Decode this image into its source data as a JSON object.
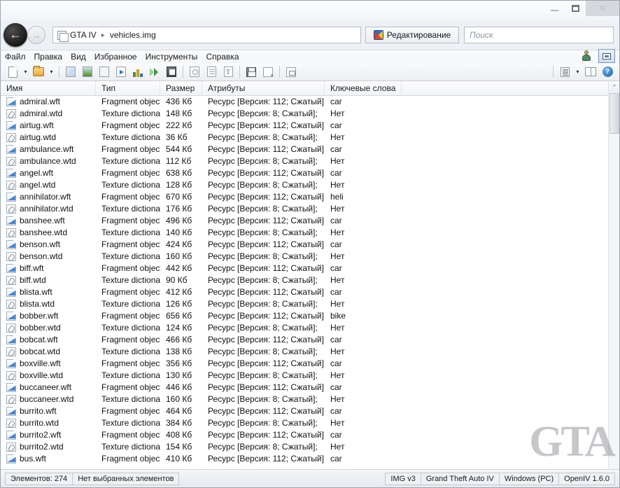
{
  "window": {
    "minimize_label": "–",
    "maximize_label": "□",
    "close_label": "✕"
  },
  "address": {
    "back_label": "←",
    "forward_label": "→",
    "crumb_root": "GTA IV",
    "crumb_sep": "▸",
    "crumb_current": "vehicles.img",
    "edit_button": "Редактирование",
    "search_placeholder": "Поиск"
  },
  "menu": {
    "items": [
      {
        "label": "Файл"
      },
      {
        "label": "Правка"
      },
      {
        "label": "Вид"
      },
      {
        "label": "Избранное"
      },
      {
        "label": "Инструменты"
      },
      {
        "label": "Справка"
      }
    ]
  },
  "toolbar": {
    "help_glyph": "?",
    "caret": "▾"
  },
  "columns": [
    {
      "key": "name",
      "label": "Имя"
    },
    {
      "key": "type",
      "label": "Тип"
    },
    {
      "key": "size",
      "label": "Размер"
    },
    {
      "key": "attr",
      "label": "Атрибуты"
    },
    {
      "key": "kw",
      "label": "Ключевые слова"
    }
  ],
  "rows": [
    {
      "icon": "wft",
      "name": "admiral.wft",
      "type": "Fragment object",
      "size": "436 Кб",
      "attr": "Ресурс [Версия: 112; Сжатый];",
      "kw": "car"
    },
    {
      "icon": "wtd",
      "name": "admiral.wtd",
      "type": "Texture dictionary",
      "size": "148 Кб",
      "attr": "Ресурс [Версия: 8; Сжатый];",
      "kw": "Нет"
    },
    {
      "icon": "wft",
      "name": "airtug.wft",
      "type": "Fragment object",
      "size": "222 Кб",
      "attr": "Ресурс [Версия: 112; Сжатый];",
      "kw": "car"
    },
    {
      "icon": "wtd",
      "name": "airtug.wtd",
      "type": "Texture dictionary",
      "size": "36 Кб",
      "attr": "Ресурс [Версия: 8; Сжатый];",
      "kw": "Нет"
    },
    {
      "icon": "wft",
      "name": "ambulance.wft",
      "type": "Fragment object",
      "size": "544 Кб",
      "attr": "Ресурс [Версия: 112; Сжатый];",
      "kw": "car"
    },
    {
      "icon": "wtd",
      "name": "ambulance.wtd",
      "type": "Texture dictionary",
      "size": "112 Кб",
      "attr": "Ресурс [Версия: 8; Сжатый];",
      "kw": "Нет"
    },
    {
      "icon": "wft",
      "name": "angel.wft",
      "type": "Fragment object",
      "size": "638 Кб",
      "attr": "Ресурс [Версия: 112; Сжатый];",
      "kw": "car"
    },
    {
      "icon": "wtd",
      "name": "angel.wtd",
      "type": "Texture dictionary",
      "size": "128 Кб",
      "attr": "Ресурс [Версия: 8; Сжатый];",
      "kw": "Нет"
    },
    {
      "icon": "wft",
      "name": "annihilator.wft",
      "type": "Fragment object",
      "size": "670 Кб",
      "attr": "Ресурс [Версия: 112; Сжатый];",
      "kw": "heli"
    },
    {
      "icon": "wtd",
      "name": "annihilator.wtd",
      "type": "Texture dictionary",
      "size": "176 Кб",
      "attr": "Ресурс [Версия: 8; Сжатый];",
      "kw": "Нет"
    },
    {
      "icon": "wft",
      "name": "banshee.wft",
      "type": "Fragment object",
      "size": "496 Кб",
      "attr": "Ресурс [Версия: 112; Сжатый];",
      "kw": "car"
    },
    {
      "icon": "wtd",
      "name": "banshee.wtd",
      "type": "Texture dictionary",
      "size": "140 Кб",
      "attr": "Ресурс [Версия: 8; Сжатый];",
      "kw": "Нет"
    },
    {
      "icon": "wft",
      "name": "benson.wft",
      "type": "Fragment object",
      "size": "424 Кб",
      "attr": "Ресурс [Версия: 112; Сжатый];",
      "kw": "car"
    },
    {
      "icon": "wtd",
      "name": "benson.wtd",
      "type": "Texture dictionary",
      "size": "160 Кб",
      "attr": "Ресурс [Версия: 8; Сжатый];",
      "kw": "Нет"
    },
    {
      "icon": "wft",
      "name": "biff.wft",
      "type": "Fragment object",
      "size": "442 Кб",
      "attr": "Ресурс [Версия: 112; Сжатый];",
      "kw": "car"
    },
    {
      "icon": "wtd",
      "name": "biff.wtd",
      "type": "Texture dictionary",
      "size": "90 Кб",
      "attr": "Ресурс [Версия: 8; Сжатый];",
      "kw": "Нет"
    },
    {
      "icon": "wft",
      "name": "blista.wft",
      "type": "Fragment object",
      "size": "412 Кб",
      "attr": "Ресурс [Версия: 112; Сжатый];",
      "kw": "car"
    },
    {
      "icon": "wtd",
      "name": "blista.wtd",
      "type": "Texture dictionary",
      "size": "126 Кб",
      "attr": "Ресурс [Версия: 8; Сжатый];",
      "kw": "Нет"
    },
    {
      "icon": "wft",
      "name": "bobber.wft",
      "type": "Fragment object",
      "size": "656 Кб",
      "attr": "Ресурс [Версия: 112; Сжатый];",
      "kw": "bike"
    },
    {
      "icon": "wtd",
      "name": "bobber.wtd",
      "type": "Texture dictionary",
      "size": "124 Кб",
      "attr": "Ресурс [Версия: 8; Сжатый];",
      "kw": "Нет"
    },
    {
      "icon": "wft",
      "name": "bobcat.wft",
      "type": "Fragment object",
      "size": "466 Кб",
      "attr": "Ресурс [Версия: 112; Сжатый];",
      "kw": "car"
    },
    {
      "icon": "wtd",
      "name": "bobcat.wtd",
      "type": "Texture dictionary",
      "size": "138 Кб",
      "attr": "Ресурс [Версия: 8; Сжатый];",
      "kw": "Нет"
    },
    {
      "icon": "wft",
      "name": "boxville.wft",
      "type": "Fragment object",
      "size": "356 Кб",
      "attr": "Ресурс [Версия: 112; Сжатый];",
      "kw": "car"
    },
    {
      "icon": "wtd",
      "name": "boxville.wtd",
      "type": "Texture dictionary",
      "size": "130 Кб",
      "attr": "Ресурс [Версия: 8; Сжатый];",
      "kw": "Нет"
    },
    {
      "icon": "wft",
      "name": "buccaneer.wft",
      "type": "Fragment object",
      "size": "446 Кб",
      "attr": "Ресурс [Версия: 112; Сжатый];",
      "kw": "car"
    },
    {
      "icon": "wtd",
      "name": "buccaneer.wtd",
      "type": "Texture dictionary",
      "size": "160 Кб",
      "attr": "Ресурс [Версия: 8; Сжатый];",
      "kw": "Нет"
    },
    {
      "icon": "wft",
      "name": "burrito.wft",
      "type": "Fragment object",
      "size": "464 Кб",
      "attr": "Ресурс [Версия: 112; Сжатый];",
      "kw": "car"
    },
    {
      "icon": "wtd",
      "name": "burrito.wtd",
      "type": "Texture dictionary",
      "size": "384 Кб",
      "attr": "Ресурс [Версия: 8; Сжатый];",
      "kw": "Нет"
    },
    {
      "icon": "wft",
      "name": "burrito2.wft",
      "type": "Fragment object",
      "size": "408 Кб",
      "attr": "Ресурс [Версия: 112; Сжатый];",
      "kw": "car"
    },
    {
      "icon": "wtd",
      "name": "burrito2.wtd",
      "type": "Texture dictionary",
      "size": "154 Кб",
      "attr": "Ресурс [Версия: 8; Сжатый];",
      "kw": "Нет"
    },
    {
      "icon": "wft",
      "name": "bus.wft",
      "type": "Fragment object",
      "size": "410 Кб",
      "attr": "Ресурс [Версия: 112; Сжатый];",
      "kw": "car"
    }
  ],
  "scrollbar": {
    "up_arrow": "⌃",
    "down_arrow": "⌄"
  },
  "watermark": {
    "text": "GTA"
  },
  "status": {
    "item_count": "Элементов: 274",
    "selection": "Нет выбранных элементов",
    "format": "IMG v3",
    "game": "Grand Theft Auto IV",
    "platform": "Windows (PC)",
    "app_version": "OpenIV 1.6.0"
  }
}
